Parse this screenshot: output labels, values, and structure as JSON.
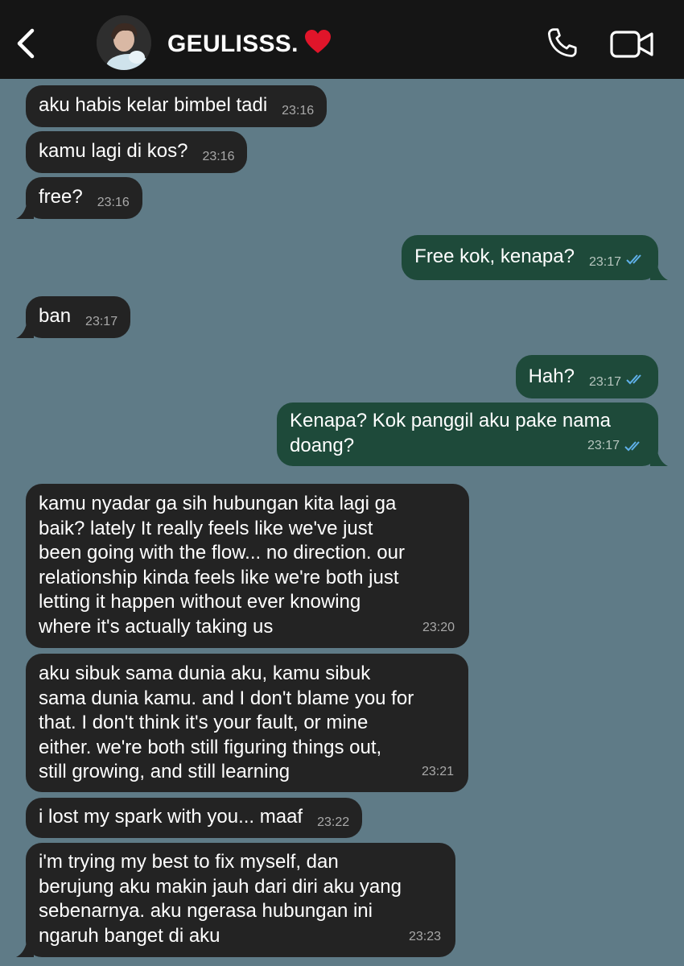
{
  "header": {
    "contact_name": "GEULISSS.",
    "back_icon": "chevron-left-icon",
    "phone_icon": "phone-icon",
    "video_icon": "video-camera-icon",
    "heart_icon": "red-heart-emoji",
    "colors": {
      "header_bg": "#151515",
      "heart": "#e0152a"
    }
  },
  "chat": {
    "background": "#5f7b87",
    "incoming_bubble_color": "#232323",
    "outgoing_bubble_color": "#1e4a3a",
    "read_ticks_color": "#5fb0e8",
    "messages": [
      {
        "dir": "in",
        "text": "aku habis kelar bimbel tadi",
        "time": "23:16"
      },
      {
        "dir": "in",
        "text": "kamu lagi di kos?",
        "time": "23:16"
      },
      {
        "dir": "in",
        "text": "free?",
        "time": "23:16"
      },
      {
        "dir": "out",
        "text": "Free kok, kenapa?",
        "time": "23:17",
        "status": "read"
      },
      {
        "dir": "in",
        "text": "ban",
        "time": "23:17"
      },
      {
        "dir": "out",
        "text": "Hah?",
        "time": "23:17",
        "status": "read"
      },
      {
        "dir": "out",
        "text": "Kenapa? Kok panggil aku pake nama\ndoang?",
        "time": "23:17",
        "status": "read"
      },
      {
        "dir": "in",
        "text": "kamu nyadar ga sih hubungan kita lagi ga\nbaik? lately It really feels like we've just\nbeen going with the flow... no direction. our\nrelationship kinda feels like we're both just\nletting it happen without ever knowing\nwhere it's actually taking us",
        "time": "23:20"
      },
      {
        "dir": "in",
        "text": "aku sibuk sama dunia aku, kamu sibuk\nsama dunia kamu. and I don't blame you for\nthat. I don't think it's your fault, or mine\neither. we're both still figuring things out,\nstill growing, and still learning",
        "time": "23:21"
      },
      {
        "dir": "in",
        "text": "i lost my spark with you... maaf",
        "time": "23:22"
      },
      {
        "dir": "in",
        "text": "i'm trying my best to fix myself, dan\nberujung aku makin jauh dari diri aku yang\nsebenarnya. aku ngerasa hubungan ini\nngaruh banget di aku",
        "time": "23:23"
      }
    ]
  }
}
